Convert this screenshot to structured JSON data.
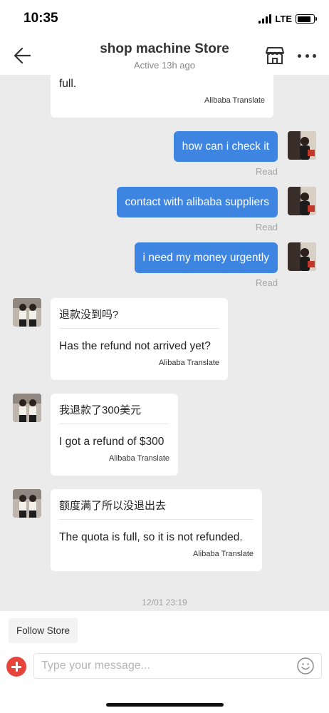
{
  "status_bar": {
    "time": "10:35",
    "network": "LTE",
    "battery_level": 0.85
  },
  "header": {
    "title": "shop machine Store",
    "subtitle": "Active 13h ago",
    "back_icon": "back-arrow-icon",
    "store_icon": "store-icon",
    "more_icon": "more-dots-icon"
  },
  "messages": [
    {
      "direction": "in",
      "original": "",
      "translation": "full.",
      "credit": "Alibaba Translate"
    },
    {
      "direction": "out",
      "text": "how can i check it",
      "status": "Read"
    },
    {
      "direction": "out",
      "text": "contact with alibaba suppliers",
      "status": "Read"
    },
    {
      "direction": "out",
      "text": "i need my money urgently",
      "status": "Read"
    },
    {
      "direction": "in",
      "original": "退款没到吗?",
      "translation": "Has the refund not arrived yet?",
      "credit": "Alibaba Translate"
    },
    {
      "direction": "in",
      "original": "我退款了300美元",
      "translation": "I got a refund of $300",
      "credit": "Alibaba Translate"
    },
    {
      "direction": "in",
      "original": "额度满了所以没退出去",
      "translation": "The quota is full, so it is not refunded.",
      "credit": "Alibaba Translate"
    }
  ],
  "timestamp": "12/01 23:19",
  "bottom": {
    "follow_label": "Follow Store",
    "input_placeholder": "Type your message...",
    "input_value": "",
    "add_icon": "add-plus-icon",
    "emoji_icon": "emoji-icon"
  },
  "colors": {
    "accent_blue": "#3d85e0",
    "add_red": "#e8443c",
    "chat_bg": "#ebebeb"
  }
}
